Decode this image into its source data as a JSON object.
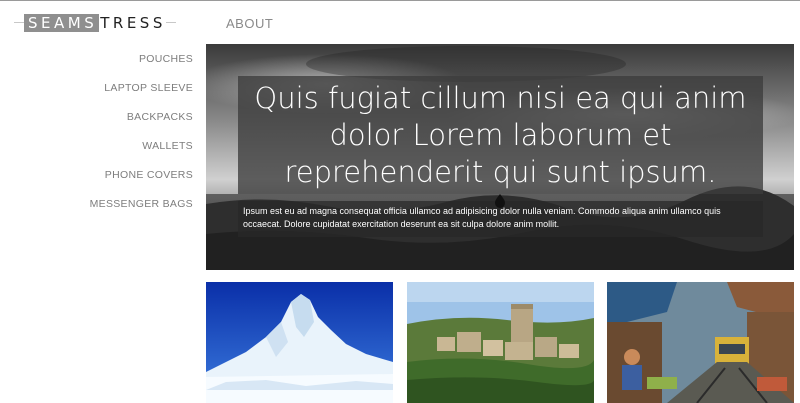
{
  "header": {
    "logo_highlight": "SEAMS",
    "logo_rest": "TRESS",
    "nav_about": "ABOUT"
  },
  "sidebar": {
    "items": [
      {
        "label": "POUCHES"
      },
      {
        "label": "LAPTOP SLEEVE"
      },
      {
        "label": "BACKPACKS"
      },
      {
        "label": "WALLETS"
      },
      {
        "label": "PHONE COVERS"
      },
      {
        "label": "MESSENGER BAGS"
      }
    ]
  },
  "hero": {
    "title": "Quis fugiat cillum nisi ea qui anim dolor Lorem laborum et reprehenderit qui sunt ipsum.",
    "subtitle": "Ipsum est eu ad magna consequat officia ullamco ad adipisicing dolor nulla veniam. Commodo aliqua anim ullamco quis occaecat. Dolore cupidatat exercitation deserunt ea sit culpa dolore anim mollit."
  },
  "thumbnails": [
    {
      "subject": "iceberg"
    },
    {
      "subject": "hill-town"
    },
    {
      "subject": "railway-market"
    }
  ],
  "colors": {
    "logo_bg": "#8f8f8f",
    "nav_text": "#8a8a8a",
    "sidebar_text": "#7d7d7d"
  }
}
